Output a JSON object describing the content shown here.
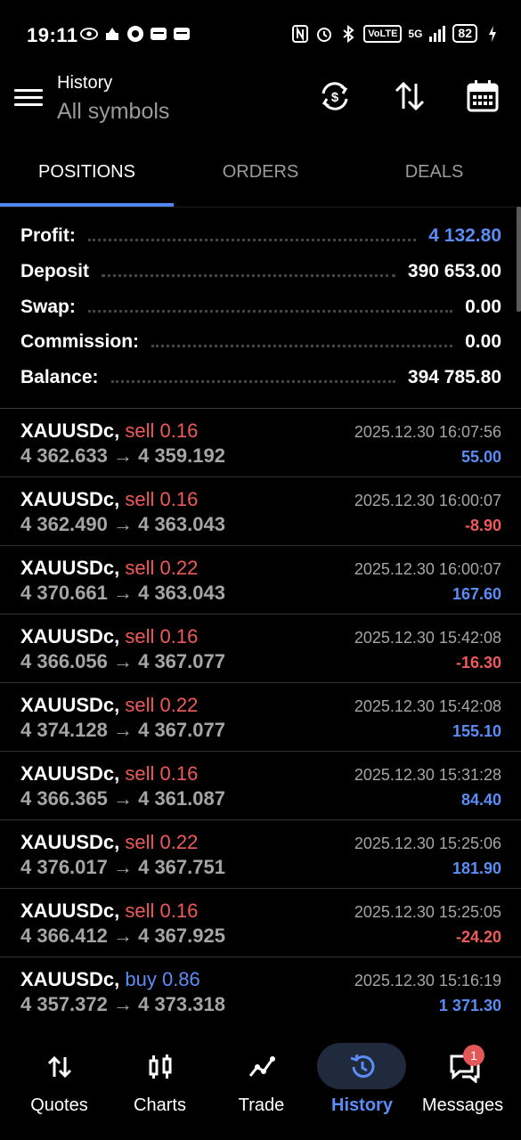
{
  "status_bar": {
    "time": "19:11",
    "volte": "VoLTE",
    "network": "5G",
    "battery": "82"
  },
  "appbar": {
    "title": "History",
    "subtitle": "All symbols"
  },
  "tabs": [
    {
      "label": "POSITIONS",
      "active": true
    },
    {
      "label": "ORDERS",
      "active": false
    },
    {
      "label": "DEALS",
      "active": false
    }
  ],
  "summary": {
    "profit": {
      "label": "Profit:",
      "value": "4 132.80"
    },
    "deposit": {
      "label": "Deposit",
      "value": "390 653.00"
    },
    "swap": {
      "label": "Swap:",
      "value": "0.00"
    },
    "commission": {
      "label": "Commission:",
      "value": "0.00"
    },
    "balance": {
      "label": "Balance:",
      "value": "394 785.80"
    }
  },
  "deals": [
    {
      "symbol": "XAUUSDc,",
      "type": "sell 0.16",
      "side": "sell",
      "prices": "4 362.633 → 4 359.192",
      "time": "2025.12.30 16:07:56",
      "profit": "55.00"
    },
    {
      "symbol": "XAUUSDc,",
      "type": "sell 0.16",
      "side": "sell",
      "prices": "4 362.490 → 4 363.043",
      "time": "2025.12.30 16:00:07",
      "profit": "-8.90"
    },
    {
      "symbol": "XAUUSDc,",
      "type": "sell 0.22",
      "side": "sell",
      "prices": "4 370.661 → 4 363.043",
      "time": "2025.12.30 16:00:07",
      "profit": "167.60"
    },
    {
      "symbol": "XAUUSDc,",
      "type": "sell 0.16",
      "side": "sell",
      "prices": "4 366.056 → 4 367.077",
      "time": "2025.12.30 15:42:08",
      "profit": "-16.30"
    },
    {
      "symbol": "XAUUSDc,",
      "type": "sell 0.22",
      "side": "sell",
      "prices": "4 374.128 → 4 367.077",
      "time": "2025.12.30 15:42:08",
      "profit": "155.10"
    },
    {
      "symbol": "XAUUSDc,",
      "type": "sell 0.16",
      "side": "sell",
      "prices": "4 366.365 → 4 361.087",
      "time": "2025.12.30 15:31:28",
      "profit": "84.40"
    },
    {
      "symbol": "XAUUSDc,",
      "type": "sell 0.22",
      "side": "sell",
      "prices": "4 376.017 → 4 367.751",
      "time": "2025.12.30 15:25:06",
      "profit": "181.90"
    },
    {
      "symbol": "XAUUSDc,",
      "type": "sell 0.16",
      "side": "sell",
      "prices": "4 366.412 → 4 367.925",
      "time": "2025.12.30 15:25:05",
      "profit": "-24.20"
    },
    {
      "symbol": "XAUUSDc,",
      "type": "buy 0.86",
      "side": "buy",
      "prices": "4 357.372 → 4 373.318",
      "time": "2025.12.30 15:16:19",
      "profit": "1 371.30"
    }
  ],
  "bottom_nav": [
    {
      "label": "Quotes",
      "icon": "quotes-arrows-icon"
    },
    {
      "label": "Charts",
      "icon": "candlestick-icon"
    },
    {
      "label": "Trade",
      "icon": "trade-line-icon"
    },
    {
      "label": "History",
      "icon": "history-clock-icon",
      "active": true
    },
    {
      "label": "Messages",
      "icon": "messages-icon",
      "badge": "1"
    }
  ],
  "colors": {
    "accent": "#5b8df7",
    "negative": "#f05a5a",
    "background": "#000000"
  }
}
